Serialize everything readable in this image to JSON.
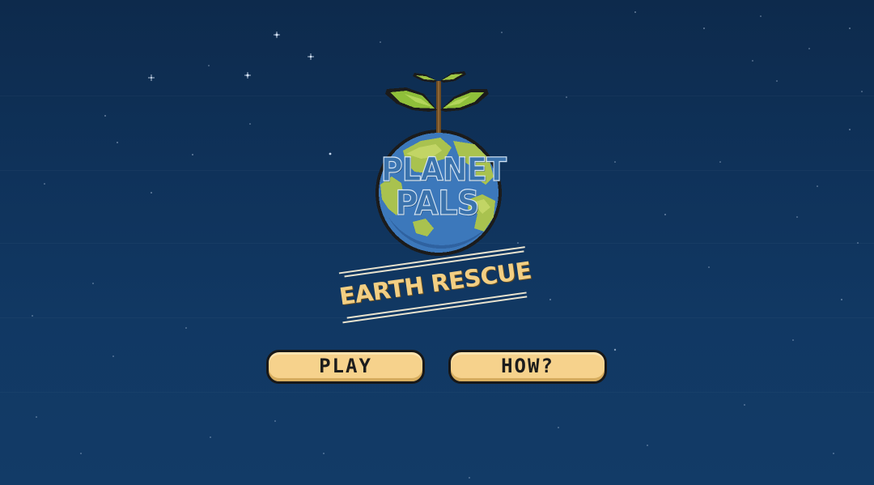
{
  "game": {
    "title_line1": "PLANET",
    "title_line2": "PALS",
    "subtitle": "EARTH RESCUE"
  },
  "menu": {
    "play_label": "PLAY",
    "how_label": "HOW?"
  },
  "colors": {
    "background": "#0f325a",
    "button_fill": "#f6d28c",
    "subtitle": "#f3cf83",
    "title": "#3b73ad",
    "leaf": "#8fbf3a",
    "ocean": "#3c78bb",
    "land": "#a9c24f"
  },
  "icons": {
    "logo": "planet-with-sprout-icon"
  }
}
